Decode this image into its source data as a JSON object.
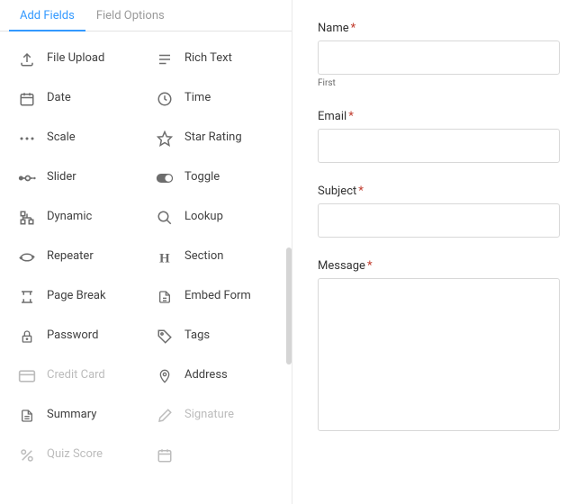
{
  "tabs": {
    "add_fields": "Add Fields",
    "field_options": "Field Options"
  },
  "fields": [
    {
      "key": "file-upload",
      "label": "File Upload",
      "icon": "upload-icon",
      "disabled": false
    },
    {
      "key": "rich-text",
      "label": "Rich Text",
      "icon": "rich-text-icon",
      "disabled": false
    },
    {
      "key": "date",
      "label": "Date",
      "icon": "calendar-icon",
      "disabled": false
    },
    {
      "key": "time",
      "label": "Time",
      "icon": "clock-icon",
      "disabled": false
    },
    {
      "key": "scale",
      "label": "Scale",
      "icon": "scale-icon",
      "disabled": false
    },
    {
      "key": "star-rating",
      "label": "Star Rating",
      "icon": "star-icon",
      "disabled": false
    },
    {
      "key": "slider",
      "label": "Slider",
      "icon": "slider-icon",
      "disabled": false
    },
    {
      "key": "toggle",
      "label": "Toggle",
      "icon": "toggle-icon",
      "disabled": false
    },
    {
      "key": "dynamic",
      "label": "Dynamic",
      "icon": "dynamic-icon",
      "disabled": false
    },
    {
      "key": "lookup",
      "label": "Lookup",
      "icon": "search-icon",
      "disabled": false
    },
    {
      "key": "repeater",
      "label": "Repeater",
      "icon": "repeater-icon",
      "disabled": false
    },
    {
      "key": "section",
      "label": "Section",
      "icon": "heading-icon",
      "disabled": false
    },
    {
      "key": "page-break",
      "label": "Page Break",
      "icon": "page-break-icon",
      "disabled": false
    },
    {
      "key": "embed-form",
      "label": "Embed Form",
      "icon": "embed-icon",
      "disabled": false
    },
    {
      "key": "password",
      "label": "Password",
      "icon": "lock-icon",
      "disabled": false
    },
    {
      "key": "tags",
      "label": "Tags",
      "icon": "tag-icon",
      "disabled": false
    },
    {
      "key": "credit-card",
      "label": "Credit Card",
      "icon": "credit-card-icon",
      "disabled": true
    },
    {
      "key": "address",
      "label": "Address",
      "icon": "pin-icon",
      "disabled": false
    },
    {
      "key": "summary",
      "label": "Summary",
      "icon": "summary-icon",
      "disabled": false
    },
    {
      "key": "signature",
      "label": "Signature",
      "icon": "signature-icon",
      "disabled": true
    },
    {
      "key": "quiz-score",
      "label": "Quiz Score",
      "icon": "percent-icon",
      "disabled": true
    },
    {
      "key": "placeholder",
      "label": "",
      "icon": "calendar-icon",
      "disabled": true
    }
  ],
  "form": {
    "name": {
      "label": "Name",
      "required": true,
      "sublabel": "First",
      "value": ""
    },
    "email": {
      "label": "Email",
      "required": true,
      "value": ""
    },
    "subject": {
      "label": "Subject",
      "required": true,
      "value": ""
    },
    "message": {
      "label": "Message",
      "required": true,
      "value": ""
    }
  }
}
